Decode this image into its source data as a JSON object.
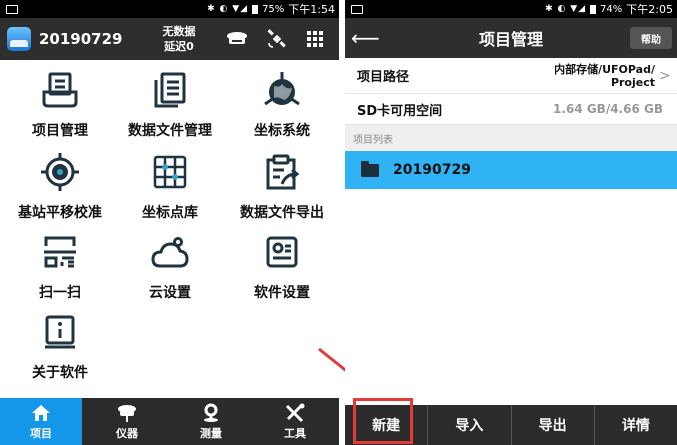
{
  "left_screen": {
    "status_bar": {
      "battery": "75%",
      "time": "下午1:54"
    },
    "header": {
      "project_name": "20190729",
      "status_line1": "无数据",
      "status_line2": "延迟0",
      "icons": [
        "receiver-icon",
        "satellite-icon",
        "grid-menu-icon"
      ]
    },
    "menu": [
      {
        "label": "项目管理",
        "icon": "project-manage-icon"
      },
      {
        "label": "数据文件管理",
        "icon": "data-file-manage-icon"
      },
      {
        "label": "坐标系统",
        "icon": "coordinate-system-icon"
      },
      {
        "label": "基站平移校准",
        "icon": "base-station-calibrate-icon"
      },
      {
        "label": "坐标点库",
        "icon": "point-library-icon"
      },
      {
        "label": "数据文件导出",
        "icon": "data-export-icon"
      },
      {
        "label": "扫一扫",
        "icon": "scan-icon"
      },
      {
        "label": "云设置",
        "icon": "cloud-settings-icon"
      },
      {
        "label": "软件设置",
        "icon": "software-settings-icon"
      },
      {
        "label": "关于软件",
        "icon": "about-icon"
      }
    ],
    "bottom_nav": [
      {
        "label": "项目",
        "icon": "home-icon",
        "active": true
      },
      {
        "label": "仪器",
        "icon": "instrument-icon",
        "active": false
      },
      {
        "label": "测量",
        "icon": "measure-icon",
        "active": false
      },
      {
        "label": "工具",
        "icon": "tools-icon",
        "active": false
      }
    ]
  },
  "right_screen": {
    "status_bar": {
      "battery": "74%",
      "time": "下午2:05"
    },
    "header": {
      "title": "项目管理",
      "help_label": "帮助"
    },
    "project_path": {
      "label": "项目路径",
      "value_line1": "内部存储/UFOPad/",
      "value_line2": "Project"
    },
    "sd_space": {
      "label": "SD卡可用空间",
      "value": "1.64 GB/4.66 GB"
    },
    "list_header": "项目列表",
    "projects": [
      {
        "name": "20190729",
        "selected": true
      }
    ],
    "bottom_buttons": [
      "新建",
      "导入",
      "导出",
      "详情"
    ]
  },
  "colors": {
    "header_bg": "#2e2e2e",
    "accent_blue": "#1497e8",
    "selected_row": "#2fb3f4",
    "icon_dark": "#1f3340",
    "highlight_red": "#e33a3a"
  }
}
